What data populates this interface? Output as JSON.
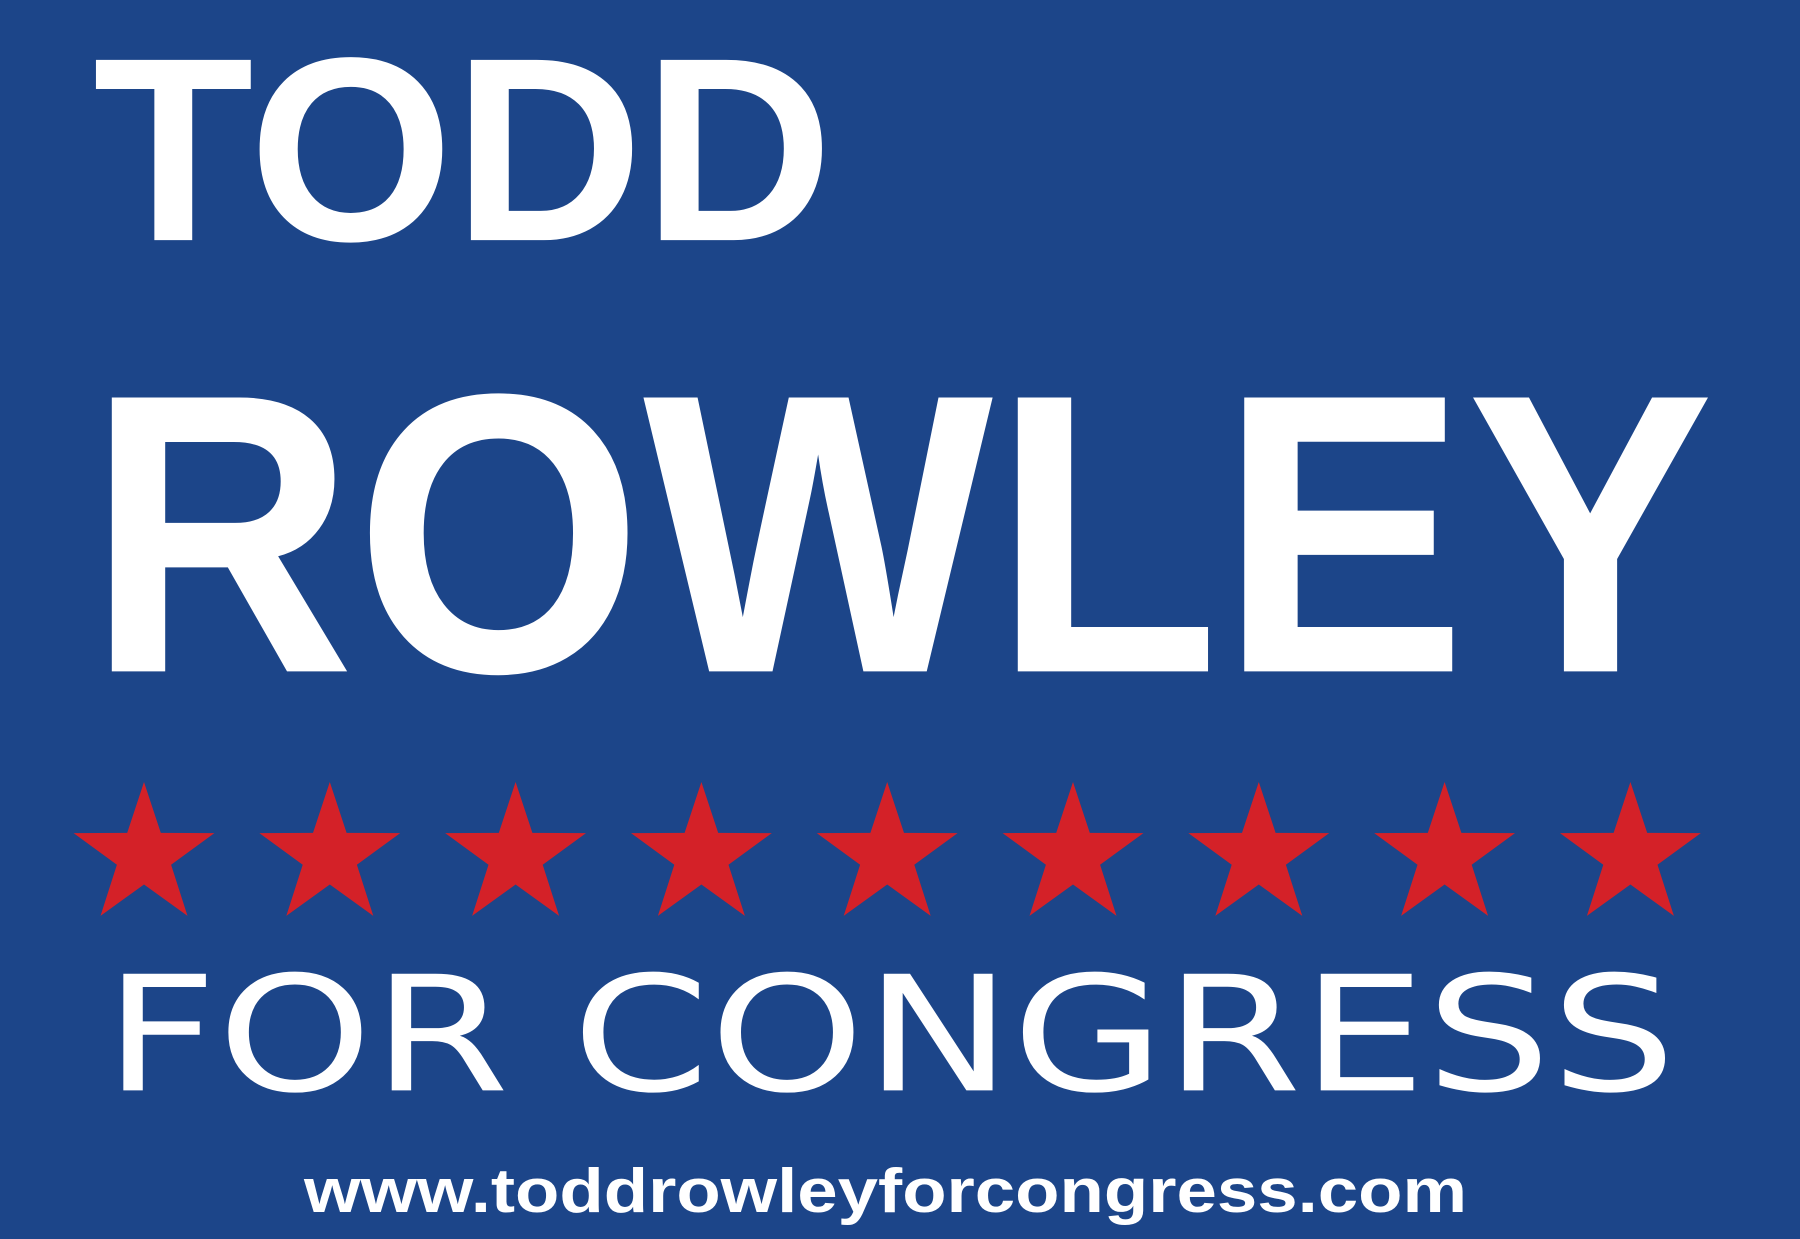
{
  "sign": {
    "first_name": "TODD",
    "last_name": "ROWLEY",
    "tagline": "FOR CONGRESS",
    "website": "www.toddrowleyforcongress.com",
    "star_count": 9,
    "colors": {
      "background": "#1c4589",
      "text": "#ffffff",
      "stars": "#d42128"
    }
  }
}
